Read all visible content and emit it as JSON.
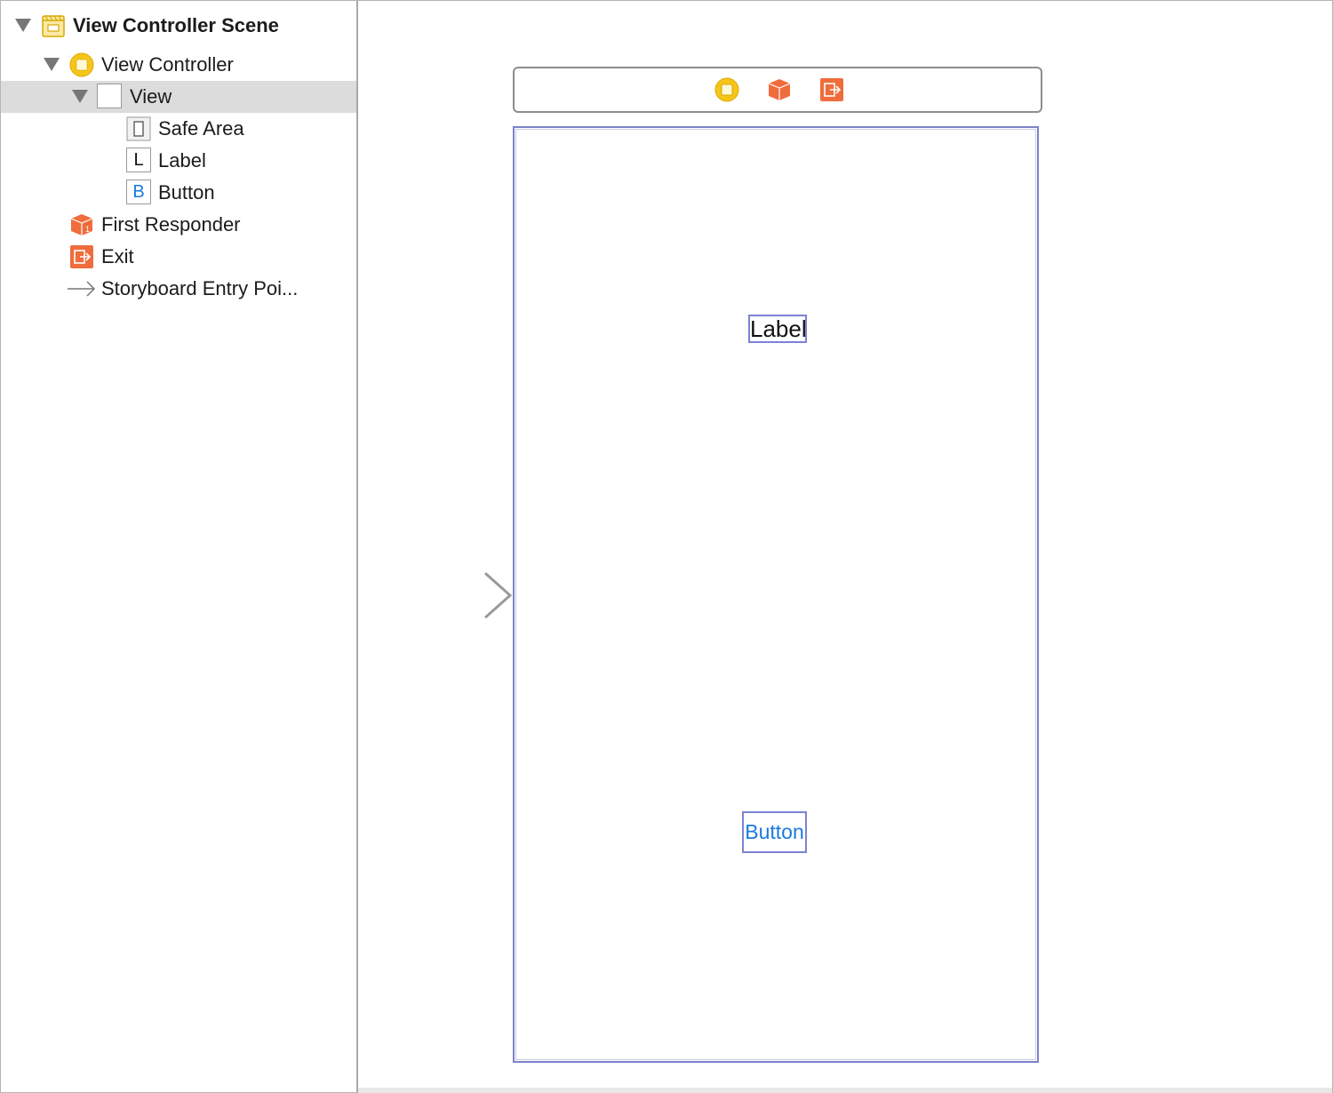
{
  "outline": {
    "items": [
      {
        "label": "View Controller Scene",
        "icon": "scene-icon"
      },
      {
        "label": "View Controller",
        "icon": "view-controller-icon"
      },
      {
        "label": "View",
        "icon": "view-icon"
      },
      {
        "label": "Safe Area",
        "icon": "safe-area-icon"
      },
      {
        "label": "Label",
        "icon": "label-icon",
        "glyph": "L"
      },
      {
        "label": "Button",
        "icon": "button-icon",
        "glyph": "B"
      },
      {
        "label": "First Responder",
        "icon": "first-responder-icon"
      },
      {
        "label": "Exit",
        "icon": "exit-icon"
      },
      {
        "label": "Storyboard Entry Poi...",
        "icon": "entry-arrow-icon"
      }
    ]
  },
  "canvas": {
    "dock_icons": [
      "view-controller-icon",
      "first-responder-icon",
      "exit-icon"
    ],
    "label_text": "Label",
    "button_text": "Button"
  },
  "colors": {
    "selection": "#dcdcdc",
    "view_controller_yellow": "#f5c518",
    "first_responder_orange": "#ef6c3d",
    "frame_border": "#7c82c8",
    "button_blue": "#1a7ae0"
  }
}
